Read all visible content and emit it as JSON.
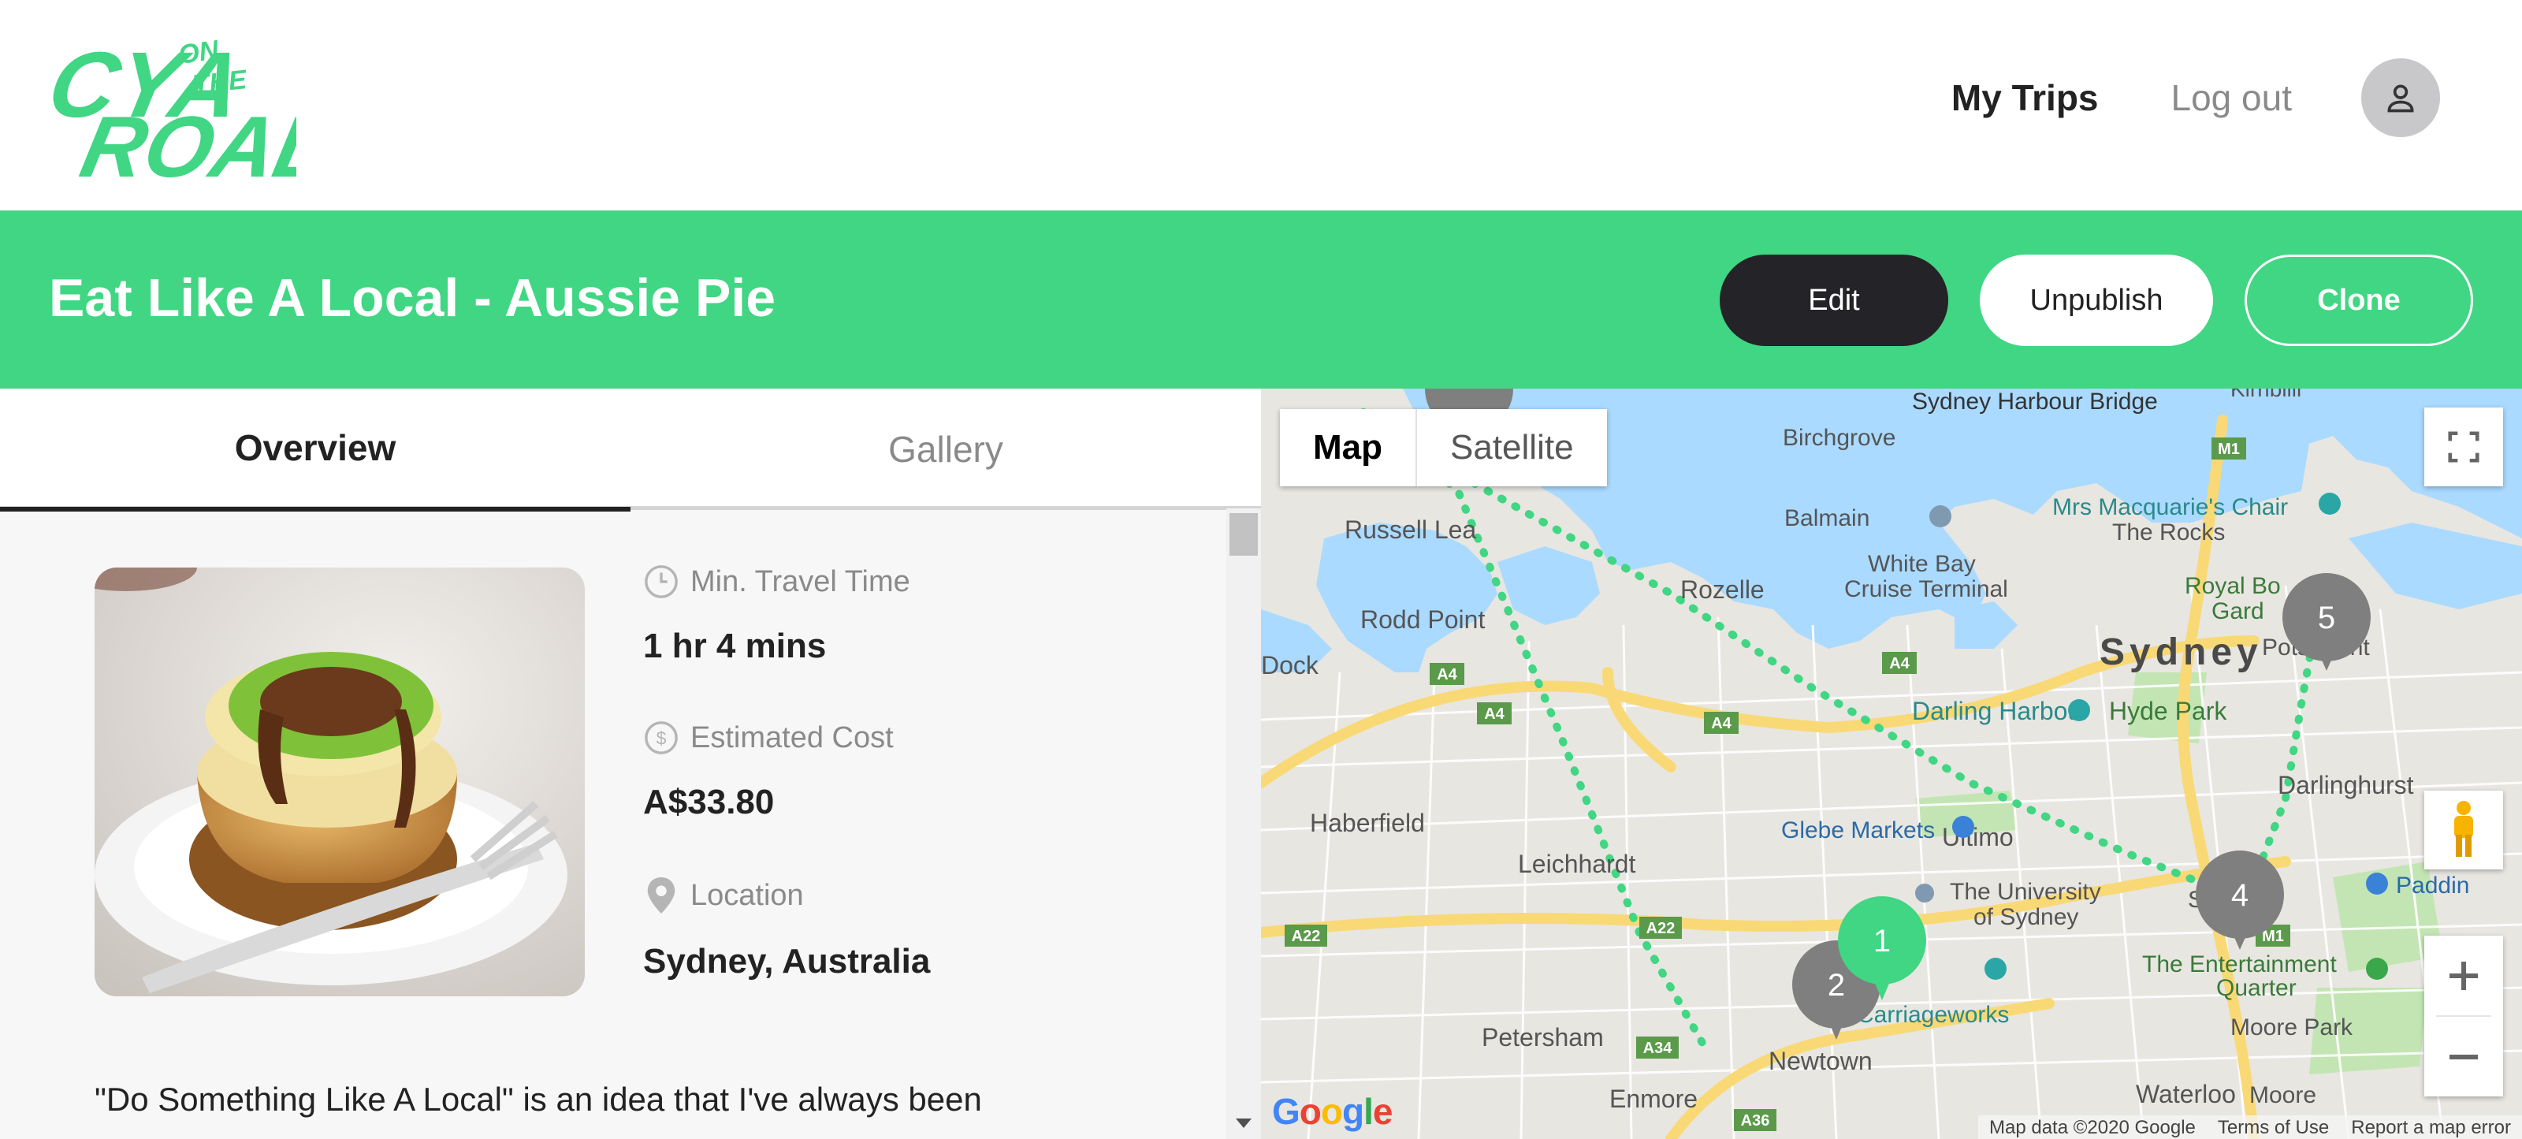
{
  "brand": {
    "logo_alt": "CYA on the Road",
    "accent": "#40d683",
    "dark": "#242327"
  },
  "nav": {
    "my_trips": "My Trips",
    "log_out": "Log out",
    "avatar_icon": "user-icon"
  },
  "trip": {
    "title": "Eat Like A Local - Aussie Pie",
    "actions": {
      "edit": "Edit",
      "unpublish": "Unpublish",
      "clone": "Clone"
    }
  },
  "tabs": {
    "overview": "Overview",
    "gallery": "Gallery",
    "active": "overview"
  },
  "details": {
    "travel_time_label": "Min. Travel Time",
    "travel_time_value": "1 hr 4 mins",
    "cost_label": "Estimated Cost",
    "cost_value": "A$33.80",
    "location_label": "Location",
    "location_value": "Sydney, Australia"
  },
  "description": "\"Do Something Like A Local\" is an idea that I've always been",
  "map": {
    "type_buttons": {
      "map": "Map",
      "satellite": "Satellite",
      "selected": "Map"
    },
    "markers": [
      {
        "label": "1",
        "color": "#40d683"
      },
      {
        "label": "2",
        "color": "#7f7f7f"
      },
      {
        "label": "4",
        "color": "#7f7f7f"
      },
      {
        "label": "5",
        "color": "#7f7f7f"
      }
    ],
    "place_labels": {
      "sydney_harbour_bridge": "Sydney Harbour Bridge",
      "kirribilli": "Kirribilli",
      "birchgrove": "Birchgrove",
      "mrs_macquaries_chair": "Mrs Macquarie's Chair",
      "the_rocks": "The Rocks",
      "balmain": "Balmain",
      "russell_lea": "Russell Lea",
      "white_bay_cruise_terminal_1": "White Bay",
      "white_bay_cruise_terminal_2": "Cruise Terminal",
      "rozelle": "Rozelle",
      "rodd_point": "Rodd Point",
      "royal_botanic_1": "Royal Bo",
      "royal_botanic_2": "Gard",
      "sydney": "Sydney",
      "potts_point": "Pots Point",
      "dock": "Dock",
      "darling_harbour": "Darling Harbour",
      "hyde_park": "Hyde Park",
      "darlinghurst": "Darlinghurst",
      "haberfield": "Haberfield",
      "glebe_markets": "Glebe Markets",
      "ultimo": "Ultimo",
      "leichhardt": "Leichhardt",
      "uni_sydney_1": "The University",
      "uni_sydney_2": "of Sydney",
      "surry": "Surry",
      "paddington": "Paddin",
      "entertainment_quarter_1": "The Entertainment",
      "entertainment_quarter_2": "Quarter",
      "carriageworks": "Carriageworks",
      "moore_park": "Moore Park",
      "petersham": "Petersham",
      "newtown": "Newtown",
      "enmore": "Enmore",
      "waterloo": "Waterloo",
      "moore": "Moore",
      "a4": "A4",
      "a22": "A22",
      "a34": "A34",
      "a36": "A36",
      "m1": "M1"
    },
    "google": "Google",
    "footer": {
      "map_data": "Map data ©2020 Google",
      "terms": "Terms of Use",
      "report": "Report a map error"
    }
  }
}
